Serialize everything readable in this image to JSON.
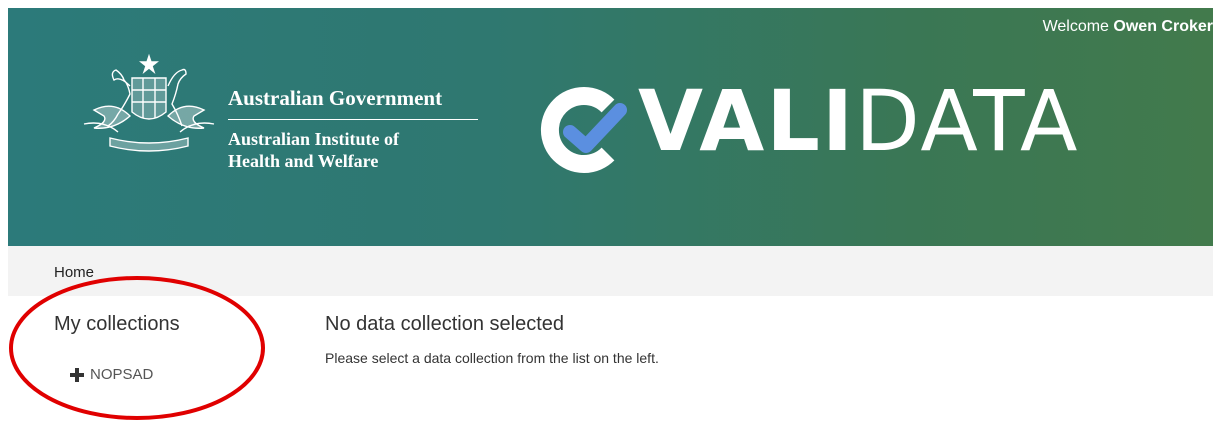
{
  "header": {
    "welcome_prefix": "Welcome",
    "user_name": "Owen Croker",
    "gov_title": "Australian Government",
    "agency_name_line1": "Australian Institute of",
    "agency_name_line2": "Health and Welfare",
    "logo_bold": "VALI",
    "logo_light": "DATA",
    "logo_icon": "check-circle-icon",
    "crest_icon": "coat-of-arms-icon"
  },
  "breadcrumb": {
    "home": "Home"
  },
  "sidebar": {
    "title": "My collections",
    "items": [
      {
        "label": "NOPSAD",
        "icon": "plus-icon"
      }
    ]
  },
  "main": {
    "title": "No data collection selected",
    "message": "Please select a data collection from the list on the left."
  },
  "colors": {
    "header_gradient_start": "#2c7a7a",
    "header_gradient_end": "#427a4c",
    "logo_check": "#5b8fe0",
    "annotation": "#e00000"
  }
}
